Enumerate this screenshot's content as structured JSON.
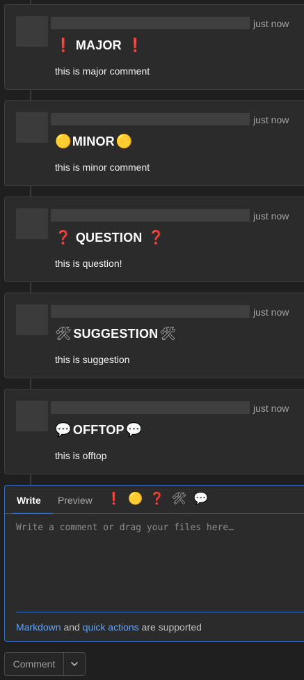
{
  "notes": [
    {
      "time": "just now",
      "emoji": "❗",
      "title": "MAJOR",
      "body": "this is major comment"
    },
    {
      "time": "just now",
      "emoji": "🟡",
      "title": "MINOR",
      "body": "this is minor comment"
    },
    {
      "time": "just now",
      "emoji": "❓",
      "title": "QUESTION",
      "body": "this is question!"
    },
    {
      "time": "just now",
      "emoji": "🛠",
      "title": "SUGGESTION",
      "body": "this is suggestion"
    },
    {
      "time": "just now",
      "emoji": "💬",
      "title": "OFFTOP",
      "body": "this is offtop"
    }
  ],
  "editor": {
    "tab_write": "Write",
    "tab_preview": "Preview",
    "toolbar_emojis": [
      "❗",
      "🟡",
      "❓",
      "🛠",
      "💬"
    ],
    "placeholder": "Write a comment or drag your files here…",
    "hint_link1": "Markdown",
    "hint_mid": " and ",
    "hint_link2": "quick actions",
    "hint_end": " are supported"
  },
  "actions": {
    "comment_label": "Comment",
    "dropdown_icon": "chevron-down-icon"
  },
  "colors": {
    "accent": "#2f6dc9",
    "link": "#63a1f2"
  }
}
